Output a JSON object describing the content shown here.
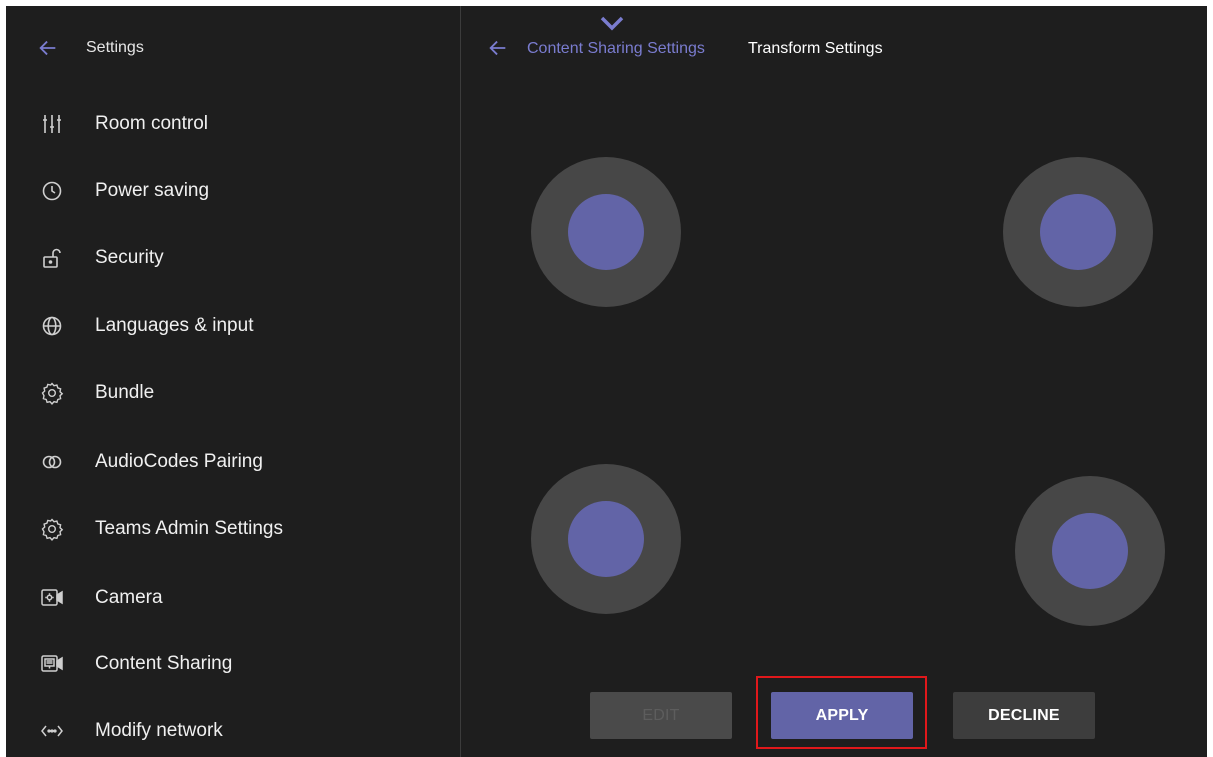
{
  "sidebar": {
    "title": "Settings",
    "items": [
      {
        "label": "Room control",
        "icon": "sliders-icon"
      },
      {
        "label": "Power saving",
        "icon": "clock-icon"
      },
      {
        "label": "Security",
        "icon": "unlock-icon"
      },
      {
        "label": "Languages & input",
        "icon": "globe-icon"
      },
      {
        "label": "Bundle",
        "icon": "gear-icon"
      },
      {
        "label": "AudioCodes Pairing",
        "icon": "pairing-rings-icon"
      },
      {
        "label": "Teams Admin Settings",
        "icon": "gear-icon"
      },
      {
        "label": "Camera",
        "icon": "camera-icon"
      },
      {
        "label": "Content Sharing",
        "icon": "content-camera-icon"
      },
      {
        "label": "Modify network",
        "icon": "network-code-icon"
      }
    ]
  },
  "header": {
    "breadcrumb_parent": "Content Sharing Settings",
    "breadcrumb_current": "Transform Settings"
  },
  "buttons": {
    "edit": "EDIT",
    "apply": "APPLY",
    "decline": "DECLINE"
  },
  "colors": {
    "accent": "#6264a7",
    "background": "#1e1e1e",
    "handle_ring": "#474747",
    "highlight": "#e0181b"
  }
}
